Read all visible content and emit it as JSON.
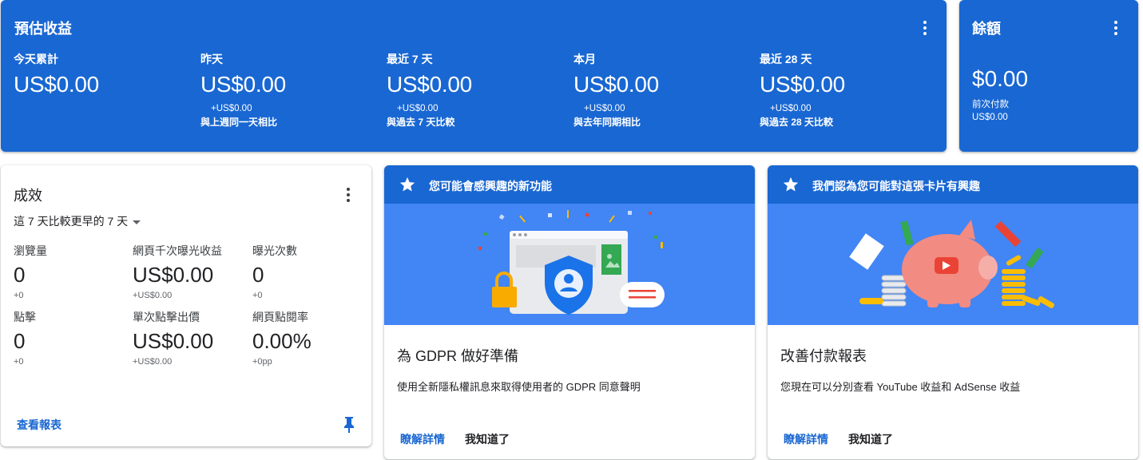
{
  "estimated": {
    "title": "預估收益",
    "metrics": [
      {
        "label": "今天累計",
        "value": "US$0.00",
        "delta": "",
        "compare": ""
      },
      {
        "label": "昨天",
        "value": "US$0.00",
        "delta": "+US$0.00",
        "compare": "與上週同一天相比"
      },
      {
        "label": "最近 7 天",
        "value": "US$0.00",
        "delta": "+US$0.00",
        "compare": "與過去 7 天比較"
      },
      {
        "label": "本月",
        "value": "US$0.00",
        "delta": "+US$0.00",
        "compare": "與去年同期相比"
      },
      {
        "label": "最近 28 天",
        "value": "US$0.00",
        "delta": "+US$0.00",
        "compare": "與過去 28 天比較"
      }
    ]
  },
  "balance": {
    "title": "餘額",
    "value": "$0.00",
    "last_payment_label": "前次付款",
    "last_payment_value": "US$0.00"
  },
  "performance": {
    "title": "成效",
    "range": "這 7 天比較更早的 7 天",
    "metrics": [
      {
        "label": "瀏覽量",
        "value": "0",
        "delta": "+0"
      },
      {
        "label": "網頁千次曝光收益",
        "value": "US$0.00",
        "delta": "+US$0.00"
      },
      {
        "label": "曝光次數",
        "value": "0",
        "delta": "+0"
      },
      {
        "label": "點擊",
        "value": "0",
        "delta": "+0"
      },
      {
        "label": "單次點擊出價",
        "value": "US$0.00",
        "delta": "+US$0.00"
      },
      {
        "label": "網頁點閱率",
        "value": "0.00%",
        "delta": "+0pp"
      }
    ],
    "report_link": "查看報表"
  },
  "cards": [
    {
      "header": "您可能會感興趣的新功能",
      "title": "為 GDPR 做好準備",
      "description": "使用全新隱私權訊息來取得使用者的 GDPR 同意聲明",
      "learn_more": "瞭解詳情",
      "dismiss": "我知道了"
    },
    {
      "header": "我們認為您可能對這張卡片有興趣",
      "title": "改善付款報表",
      "description": "您現在可以分別查看 YouTube 收益和 AdSense 收益",
      "learn_more": "瞭解詳情",
      "dismiss": "我知道了"
    }
  ],
  "colors": {
    "primary": "#1967d2",
    "illustration_bg": "#4285f4"
  },
  "icons": [
    "more-vert-icon",
    "caret-down-icon",
    "pin-icon",
    "star-icon"
  ]
}
